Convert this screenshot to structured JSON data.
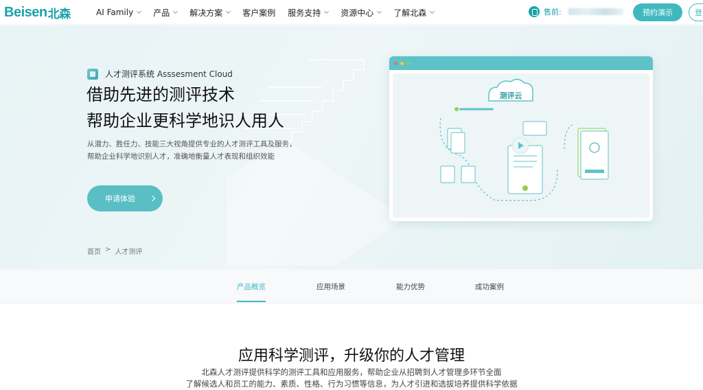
{
  "nav": {
    "logo_text": "Beisen",
    "logo_cn": "北森",
    "menu": [
      "AI Family",
      "产品",
      "解决方案",
      "客户案例",
      "服务支持",
      "资源中心",
      "了解北森"
    ],
    "menu_has_chevron": [
      true,
      true,
      true,
      false,
      true,
      true,
      true
    ],
    "phone_label": "售前:",
    "demo_button": "预约演示",
    "login_button": "登"
  },
  "hero": {
    "tag": "人才测评系统 Asssesment Cloud",
    "title_line1": "借助先进的测评技术",
    "title_line2": "帮助企业更科学地识人用人",
    "desc": "从潜力、胜任力、技能三大视角提供专业的人才测评工具及服务，帮助企业科学地识别人才，准确地衡量人才表现和组织效能",
    "apply_button": "申请体验",
    "cloud_label": "测评云",
    "breadcrumb": [
      "首页",
      ">",
      "人才测评"
    ]
  },
  "tabs": [
    "产品概览",
    "应用场景",
    "能力优势",
    "成功案例"
  ],
  "section": {
    "title": "应用科学测评，升级你的人才管理",
    "desc_line1": "北森人才测评提供科学的测评工具和应用服务，帮助企业从招聘到人才管理多环节全面",
    "desc_line2": "了解候选人和员工的能力、素质、性格、行为习惯等信息，为人才引进和选拔培养提供科学依据"
  },
  "colors": {
    "accent": "#3fb9bf",
    "brand": "#1aa3ab"
  }
}
